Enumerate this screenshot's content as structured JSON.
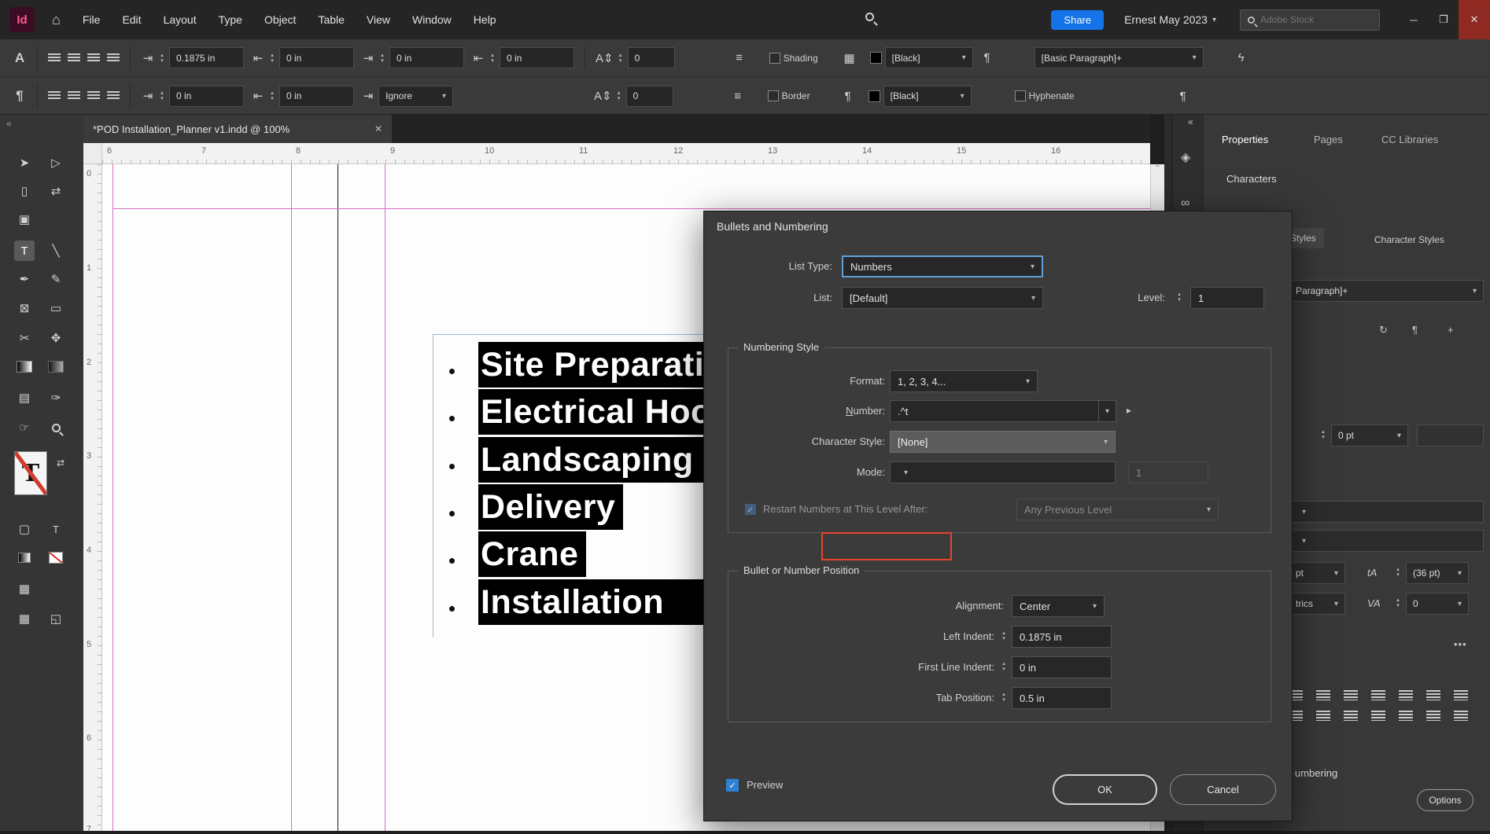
{
  "icons": {
    "home": "⌂",
    "chevron": "▾",
    "flyout": "▸",
    "minimize": "─",
    "restore": "❐",
    "close": "✕",
    "collapse": "«",
    "scroll_up": "⌃",
    "char_a": "A",
    "pilcrow": "¶",
    "dropdown_chevron": "▾",
    "indent_first": "⇥",
    "indent_last": "⇤",
    "space_para": "A⇕",
    "list_bullets": "≡",
    "list_numbers": "≡",
    "grid": "▦",
    "bolt": "ϟ",
    "para_box": "¶",
    "selection": "➤",
    "direct_selection": "▷",
    "page_tool": "▯",
    "gap_tool": "⇄",
    "content_collector": "▣",
    "type_tool": "T",
    "line_tool": "╲",
    "pen_tool": "✒",
    "pencil_tool": "✎",
    "frame_tool": "⊠",
    "rect_tool": "▭",
    "scissors_tool": "✂",
    "free_transform": "✥",
    "note_tool": "▤",
    "eyedropper_tool": "✑",
    "hand_tool": "☞",
    "swap_arrows": "⇄",
    "container": "▢",
    "text_t": "T",
    "screen_normal": "▦",
    "screen_preview": "◱",
    "proxy_t": "T",
    "layers": "◈",
    "link": "∞",
    "style_a": "↻",
    "style_b": "¶",
    "style_c": "+",
    "leading": "tA",
    "kerning": "VA",
    "dots": "•••"
  },
  "appbar": {
    "logo": "Id",
    "menus": [
      "File",
      "Edit",
      "Layout",
      "Type",
      "Object",
      "Table",
      "View",
      "Window",
      "Help"
    ],
    "share": "Share",
    "workspace": "Ernest May 2023",
    "stock_search": "Adobe Stock"
  },
  "control_panel": {
    "row1": {
      "v1": "0.1875 in",
      "v2": "0 in",
      "v3": "0 in",
      "v4": "0 in",
      "v5": "0",
      "shading": "Shading",
      "swatch": "[Black]",
      "style": "[Basic Paragraph]+"
    },
    "row2": {
      "v1": "0 in",
      "v2": "0 in",
      "keep": "Ignore",
      "v3": "0",
      "border": "Border",
      "swatch": "[Black]",
      "hyphenate": "Hyphenate"
    }
  },
  "document": {
    "tab_title": "*POD Installation_Planner v1.indd @ 100%",
    "ruler_h": [
      "6",
      "7",
      "8",
      "9",
      "10",
      "11",
      "12",
      "13",
      "14",
      "15",
      "16"
    ],
    "ruler_v": [
      "0",
      "1",
      "2",
      "3",
      "4",
      "5",
      "6",
      "7"
    ],
    "list_items": [
      "Site Preparation",
      "Electrical Hookup",
      "Landscaping",
      "Delivery",
      "Crane",
      "Installation"
    ]
  },
  "dialog": {
    "title": "Bullets and Numbering",
    "list_type": {
      "label": "List Type:",
      "value": "Numbers"
    },
    "list": {
      "label": "List:",
      "value": "[Default]"
    },
    "level": {
      "label": "Level:",
      "value": "1"
    },
    "numbering": {
      "legend": "Numbering Style",
      "format": {
        "label": "Format:",
        "value": "1, 2, 3, 4..."
      },
      "number": {
        "label": "Number:",
        "value": ".^t"
      },
      "character_style": {
        "label": "Character Style:",
        "value": "[None]"
      },
      "mode": {
        "label": "Mode:",
        "value": "",
        "start_at": "1"
      },
      "restart": {
        "label": "Restart Numbers at This Level After:",
        "value": "Any Previous Level"
      }
    },
    "position": {
      "legend": "Bullet or Number Position",
      "alignment": {
        "label": "Alignment:",
        "value": "Center"
      },
      "left_indent": {
        "label": "Left Indent:",
        "value": "0.1875 in"
      },
      "first_line_indent": {
        "label": "First Line Indent:",
        "value": "0 in"
      },
      "tab_position": {
        "label": "Tab Position:",
        "value": "0.5 in"
      }
    },
    "preview_label": "Preview",
    "ok": "OK",
    "cancel": "Cancel"
  },
  "right_panel": {
    "tabs": [
      "Properties",
      "Pages",
      "CC Libraries"
    ],
    "characters_label": "Characters",
    "style_tab_left": "Styles",
    "style_tab_right": "Character Styles",
    "paragraph_style_partial": "Paragraph]+",
    "stroke_value": "0 pt",
    "size_unit_partial": "pt",
    "leading_value": "(36 pt)",
    "kerning_partial": "trics",
    "tracking_value": "0",
    "numbering_partial": "umbering",
    "options_button": "Options"
  }
}
